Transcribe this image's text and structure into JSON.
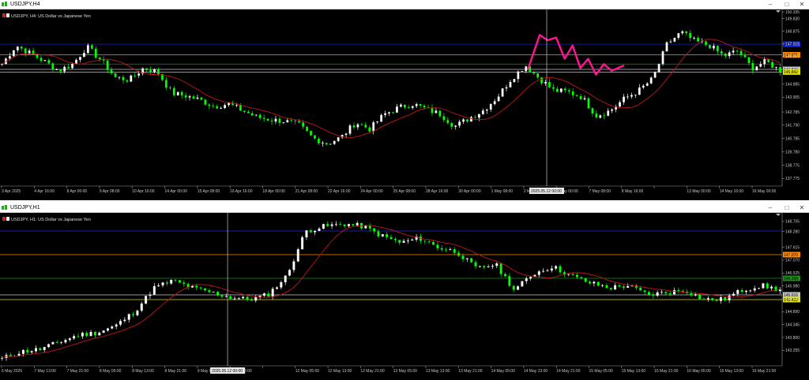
{
  "colors": {
    "background": "#000000",
    "bull_candle": "#ffffff",
    "bear_candle": "#00ff00",
    "ma": "#c0151a",
    "zigzag": "#ff1493",
    "crosshair": "#c8c8c8",
    "level_blue": "#1a2bd6",
    "level_orange": "#ff8c00",
    "level_green": "#1e8a1e",
    "level_white": "#c8c8c8",
    "level_yellow": "#e0e000"
  },
  "windows": [
    {
      "title": "USDJPY,H4",
      "symbol_label": "USDJPY, H4:  US Dollar vs Japanese Yen",
      "controls": [
        "–",
        "□",
        "✕"
      ],
      "chart_data": {
        "type": "candlestick",
        "symbol": "USDJPY",
        "timeframe": "H4",
        "ylim": [
          137.2,
          150.4
        ],
        "price_ticks": [
          "150.335",
          "149.830",
          "148.875",
          "147.915",
          "146.955",
          "145.990",
          "144.885",
          "143.905",
          "142.785",
          "141.790",
          "140.785",
          "139.780",
          "138.775",
          "137.775"
        ],
        "time_ticks": [
          "3 Apr 2025",
          "4 Apr 16:00",
          "8 Apr 00:00",
          "9 Apr 08:00",
          "10 Apr 16:00",
          "14 Apr 00:00",
          "15 Apr 08:00",
          "16 Apr 16:00",
          "18 Apr 00:00",
          "21 Apr 08:00",
          "22 Apr 16:00",
          "24 Apr 00:00",
          "25 Apr 08:00",
          "28 Apr 16:00",
          "30 Apr 00:00",
          "1 May 08:00",
          "2 May 16:00",
          "6 May 00:00",
          "7 May 08:00",
          "8 May 16:00",
          "2025.05.12 00:00",
          "13 May 00:00",
          "14 May 16:00",
          "16 May 00:00"
        ],
        "crosshair_time": "2025.05.12 00:00",
        "anchors": [
          146.4,
          147.8,
          147.2,
          146.6,
          145.9,
          146.4,
          147.7,
          146.7,
          145.4,
          145.2,
          146.1,
          145.8,
          144.2,
          144.0,
          143.7,
          143.2,
          143.4,
          142.9,
          142.4,
          142.2,
          142.1,
          141.8,
          140.8,
          140.4,
          140.9,
          142.0,
          141.5,
          142.6,
          143.1,
          143.4,
          143.0,
          142.6,
          141.7,
          142.3,
          142.9,
          143.9,
          145.3,
          146.3,
          145.3,
          144.4,
          144.3,
          143.9,
          142.5,
          142.9,
          143.8,
          144.4,
          145.3,
          147.9,
          148.8,
          148.1,
          147.8,
          147.0,
          147.4,
          146.1,
          146.6,
          145.9
        ],
        "series": [
          {
            "name": "MA",
            "color": "#c0151a"
          }
        ],
        "levels": [
          {
            "price": 147.9,
            "color": "#1a2bd6",
            "tag": "147.871"
          },
          {
            "price": 147.1,
            "color": "#ff8c00",
            "tag": "147.071"
          },
          {
            "price": 146.4,
            "color": "#1e8a1e",
            "tag": ""
          },
          {
            "price": 146.0,
            "color": "#c8c8c8",
            "tag": "146.096"
          },
          {
            "price": 145.8,
            "color": "#e0e000",
            "tag": "145.842"
          }
        ],
        "zigzag": [
          [
            0.675,
            146.0
          ],
          [
            0.69,
            148.6
          ],
          [
            0.7,
            148.2
          ],
          [
            0.711,
            148.4
          ],
          [
            0.722,
            146.8
          ],
          [
            0.732,
            147.8
          ],
          [
            0.742,
            146.1
          ],
          [
            0.752,
            146.8
          ],
          [
            0.762,
            145.6
          ],
          [
            0.772,
            146.4
          ],
          [
            0.782,
            145.9
          ],
          [
            0.798,
            146.3
          ]
        ]
      }
    },
    {
      "title": "USDJPY,H1",
      "symbol_label": "USDJPY, H1:  US Dollar vs Japanese Yen",
      "controls": [
        "–",
        "□",
        "✕"
      ],
      "chart_data": {
        "type": "candlestick",
        "symbol": "USDJPY",
        "timeframe": "H1",
        "ylim": [
          142.6,
          149.0
        ],
        "price_ticks": [
          "148.705",
          "148.280",
          "147.615",
          "147.070",
          "146.525",
          "145.980",
          "145.435",
          "144.890",
          "144.345",
          "143.800",
          "143.255"
        ],
        "time_ticks": [
          "6 May 2025",
          "7 May 13:00",
          "7 May 21:00",
          "8 May 05:00",
          "8 May 13:00",
          "8 May 21:00",
          "9 May 05:00",
          "9 May 13:00",
          "2025.05.12 00:00",
          "12 May 05:00",
          "12 May 13:00",
          "12 May 21:00",
          "13 May 05:00",
          "13 May 13:00",
          "13 May 21:00",
          "14 May 05:00",
          "14 May 13:00",
          "14 May 21:00",
          "15 May 05:00",
          "15 May 13:00",
          "15 May 21:00",
          "16 May 05:00",
          "16 May 13:00",
          "16 May 21:00"
        ],
        "crosshair_time": "2025.05.12 00:00",
        "anchors": [
          142.9,
          143.2,
          143.3,
          143.6,
          143.9,
          144.0,
          144.3,
          144.9,
          145.9,
          146.2,
          145.9,
          145.7,
          145.5,
          145.4,
          145.6,
          146.4,
          148.3,
          148.5,
          148.6,
          148.5,
          148.1,
          147.8,
          148.0,
          147.6,
          147.4,
          146.7,
          146.9,
          145.8,
          146.5,
          146.8,
          146.4,
          146.1,
          145.9,
          146.0,
          145.6,
          145.7,
          145.8,
          145.4,
          145.4,
          145.8,
          146.0,
          145.8
        ],
        "series": [
          {
            "name": "MA",
            "color": "#c0151a"
          }
        ],
        "levels": [
          {
            "price": 148.3,
            "color": "#1a2bd6",
            "tag": ""
          },
          {
            "price": 147.3,
            "color": "#ff8c00",
            "tag": "147.070"
          },
          {
            "price": 146.3,
            "color": "#1e8a1e",
            "tag": "146.209"
          },
          {
            "price": 145.6,
            "color": "#c8c8c8",
            "tag": "145.616"
          },
          {
            "price": 145.4,
            "color": "#e0e000",
            "tag": "145.422"
          }
        ],
        "zigzag": []
      }
    }
  ]
}
